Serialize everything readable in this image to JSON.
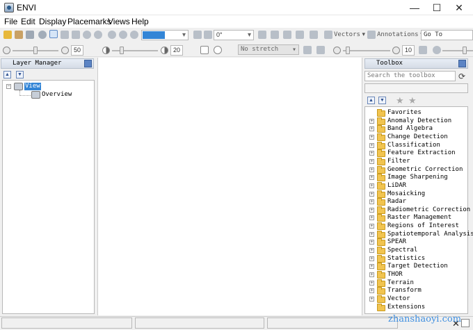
{
  "window": {
    "title": "ENVI",
    "minimize": "—",
    "maximize": "☐",
    "close": "✕"
  },
  "menu": {
    "items": [
      "File",
      "Edit",
      "Display",
      "Placemarks",
      "Views",
      "Help"
    ]
  },
  "toolbar": {
    "zoom_value": "",
    "rotation_value": "0°",
    "vectors_label": "Vectors",
    "annotations_label": "Annotations",
    "goto_placeholder": "Go To",
    "brightness_value": "50",
    "contrast_value": "20",
    "stretch_value": "No stretch",
    "sharpen_value": "10"
  },
  "layer_manager": {
    "title": "Layer Manager",
    "root_label": "View",
    "child_label": "Overview"
  },
  "toolbox": {
    "title": "Toolbox",
    "search_placeholder": "Search the toolbox",
    "items": [
      "Favorites",
      "Anomaly Detection",
      "Band Algebra",
      "Change Detection",
      "Classification",
      "Feature Extraction",
      "Filter",
      "Geometric Correction",
      "Image Sharpening",
      "LiDAR",
      "Mosaicking",
      "Radar",
      "Radiometric Correction",
      "Raster Management",
      "Regions of Interest",
      "Spatiotemporal Analysis",
      "SPEAR",
      "Spectral",
      "Statistics",
      "Target Detection",
      "THOR",
      "Terrain",
      "Transform",
      "Vector",
      "Extensions"
    ]
  },
  "watermark": "zhanshaoyi.com",
  "colors": {
    "selection": "#3385d6",
    "accent": "#2d4f8f"
  }
}
